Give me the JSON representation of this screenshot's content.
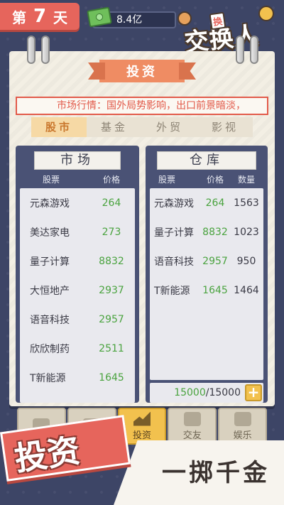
{
  "top_bar": {
    "day_prefix": "第",
    "day_number": "7",
    "day_suffix": "天",
    "money": "8.4亿"
  },
  "logo": {
    "main": "交换人生",
    "badge": "换"
  },
  "section": {
    "title": "投资"
  },
  "ticker": "市场行情：国外局势影响，出口前景暗淡，",
  "tabs": [
    {
      "label": "股市",
      "active": true
    },
    {
      "label": "基金",
      "active": false
    },
    {
      "label": "外贸",
      "active": false
    },
    {
      "label": "影视",
      "active": false
    }
  ],
  "market": {
    "title": "市场",
    "headers": [
      "股票",
      "价格"
    ],
    "rows": [
      {
        "name": "元森游戏",
        "price": "264"
      },
      {
        "name": "美达家电",
        "price": "273"
      },
      {
        "name": "量子计算",
        "price": "8832"
      },
      {
        "name": "大恒地产",
        "price": "2937"
      },
      {
        "name": "语音科技",
        "price": "2957"
      },
      {
        "name": "欣欣制药",
        "price": "2511"
      },
      {
        "name": "T新能源",
        "price": "1645"
      }
    ]
  },
  "store": {
    "title": "仓库",
    "headers": [
      "股票",
      "价格",
      "数量"
    ],
    "rows": [
      {
        "name": "元森游戏",
        "price": "264",
        "qty": "1563"
      },
      {
        "name": "量子计算",
        "price": "8832",
        "qty": "1023"
      },
      {
        "name": "语音科技",
        "price": "2957",
        "qty": "950"
      },
      {
        "name": "T新能源",
        "price": "1645",
        "qty": "1464"
      }
    ],
    "capacity_used": "15000",
    "capacity_sep": "/",
    "capacity_total": "15000",
    "plus_label": "+"
  },
  "nav": [
    {
      "label": "",
      "icon": "bag-icon",
      "active": false
    },
    {
      "label": "",
      "icon": "money-icon",
      "active": false
    },
    {
      "label": "投资",
      "icon": "chart-icon",
      "active": true
    },
    {
      "label": "交友",
      "icon": "hearts-icon",
      "active": false
    },
    {
      "label": "娱乐",
      "icon": "club-icon",
      "active": false
    }
  ],
  "promo": {
    "title": "投资",
    "slogan": "一掷千金"
  },
  "colors": {
    "accent": "#e6655c",
    "price_green": "#4aa33f",
    "panel": "#4a5275",
    "gold": "#f2c14e"
  }
}
